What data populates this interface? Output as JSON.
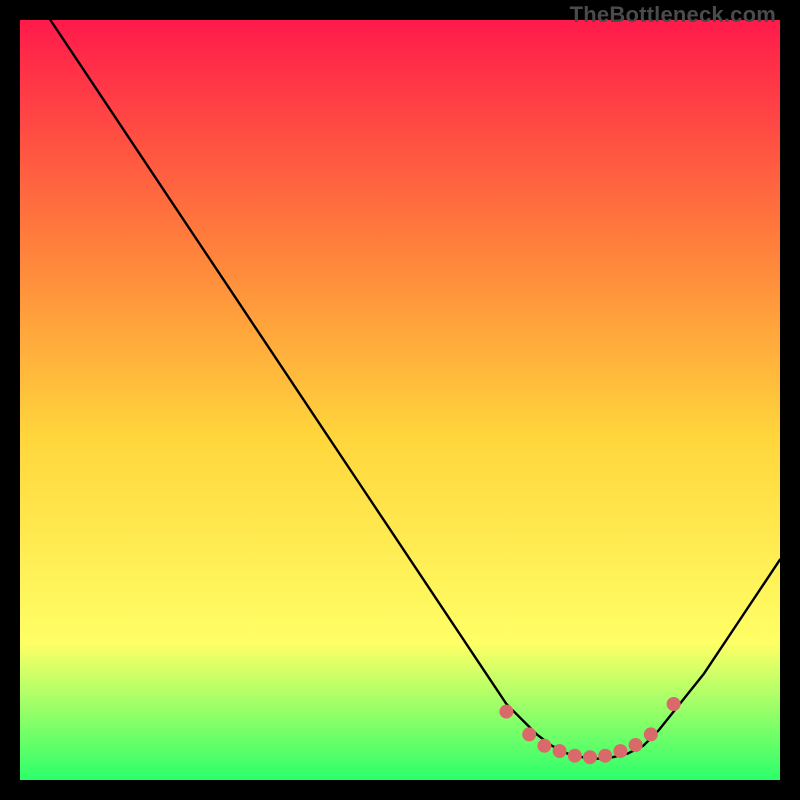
{
  "watermark": "TheBottleneck.com",
  "colors": {
    "gradient_top": "#ff1a4b",
    "gradient_mid1": "#ff7a3c",
    "gradient_mid2": "#ffd63c",
    "gradient_mid3": "#ffff66",
    "gradient_bottom": "#2bff6a",
    "curve": "#000000",
    "markers": "#da6a6a",
    "frame_bg": "#000000"
  },
  "chart_data": {
    "type": "line",
    "title": "",
    "xlabel": "",
    "ylabel": "",
    "xlim": [
      0,
      100
    ],
    "ylim": [
      0,
      100
    ],
    "series": [
      {
        "name": "bottleneck-curve",
        "x": [
          4,
          8,
          12,
          16,
          20,
          24,
          28,
          32,
          36,
          40,
          44,
          48,
          52,
          56,
          60,
          62,
          64,
          66,
          68,
          70,
          72,
          74,
          76,
          78,
          80,
          82,
          84,
          86,
          90,
          94,
          98,
          100
        ],
        "y": [
          100,
          94,
          88,
          82,
          76,
          70,
          64,
          58,
          52,
          46,
          40,
          34,
          28,
          22,
          16,
          13,
          10,
          8,
          6,
          4.5,
          3.5,
          3,
          2.8,
          3,
          3.5,
          4.5,
          6.5,
          9,
          14,
          20,
          26,
          29
        ]
      }
    ],
    "markers": {
      "name": "bottom-cluster",
      "points": [
        {
          "x": 64,
          "y": 9
        },
        {
          "x": 67,
          "y": 6
        },
        {
          "x": 69,
          "y": 4.5
        },
        {
          "x": 71,
          "y": 3.8
        },
        {
          "x": 73,
          "y": 3.2
        },
        {
          "x": 75,
          "y": 3
        },
        {
          "x": 77,
          "y": 3.2
        },
        {
          "x": 79,
          "y": 3.8
        },
        {
          "x": 81,
          "y": 4.6
        },
        {
          "x": 83,
          "y": 6
        },
        {
          "x": 86,
          "y": 10
        }
      ]
    }
  }
}
